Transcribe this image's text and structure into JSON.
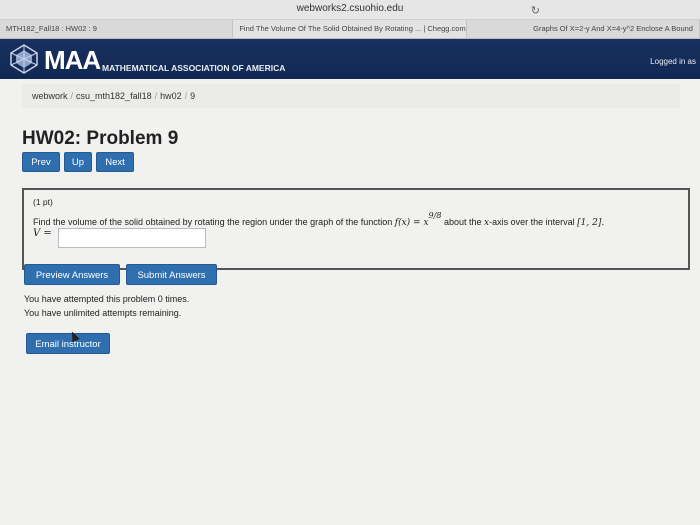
{
  "browser": {
    "url": "webworks2.csuohio.edu",
    "reload_icon": "↻",
    "tabs": [
      {
        "label": "MTH182_Fall18 : HW02 : 9"
      },
      {
        "label": "Find The Volume Of The Solid Obtained By Rotating ... | Chegg.com"
      },
      {
        "label": "Graphs Of X=2-y And X=4-y^2 Enclose A Bound"
      }
    ]
  },
  "header": {
    "logo_abbr": "MAA",
    "logo_full": "MATHEMATICAL ASSOCIATION OF AMERICA",
    "logged_in": "Logged in as",
    "brand_color": "#18305e"
  },
  "breadcrumb": {
    "items": [
      "webwork",
      "csu_mth182_fall18",
      "hw02",
      "9"
    ],
    "separator": "/"
  },
  "page_title": "HW02: Problem 9",
  "nav": {
    "prev": "Prev",
    "up": "Up",
    "next": "Next"
  },
  "problem": {
    "points": "(1 pt)",
    "text_before": "Find the volume of the solid obtained by rotating the region under the graph of the function",
    "function": "f(x) = x",
    "exponent": "9/8",
    "text_after": "about the",
    "axis": "x",
    "text_axis": "-axis over the interval",
    "interval": "[1, 2].",
    "answer_label": "V =",
    "answer_value": ""
  },
  "actions": {
    "preview": "Preview Answers",
    "submit": "Submit Answers"
  },
  "status": {
    "attempts": "You have attempted this problem 0 times.",
    "remaining": "You have unlimited attempts remaining."
  },
  "email_button": "Email instructor",
  "accent_color": "#2f6fb0"
}
